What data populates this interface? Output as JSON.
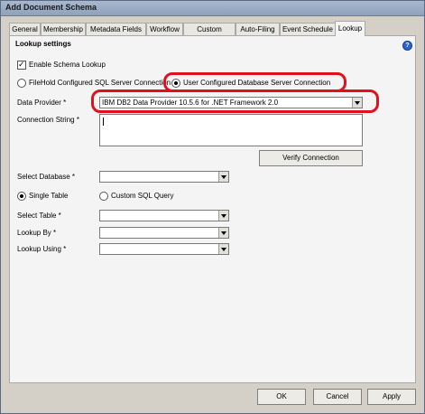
{
  "window": {
    "title": "Add Document Schema"
  },
  "tabs": [
    {
      "label": "General"
    },
    {
      "label": "Membership"
    },
    {
      "label": "Metadata Fields"
    },
    {
      "label": "Workflow"
    },
    {
      "label": "Custom Naming"
    },
    {
      "label": "Auto-Filing"
    },
    {
      "label": "Event Schedule"
    },
    {
      "label": "Lookup"
    }
  ],
  "lookup": {
    "heading": "Lookup settings",
    "help_icon": "question-icon",
    "enable_schema_lookup": {
      "label": "Enable Schema Lookup",
      "checked": true
    },
    "connection_type": {
      "option1": "FileHold Configured SQL Server Connection",
      "option2": "User Configured Database Server Connection",
      "selected": "User Configured Database Server Connection"
    },
    "data_provider": {
      "label": "Data Provider *",
      "value": "IBM DB2 Data Provider 10.5.6 for .NET Framework 2.0"
    },
    "connection_string": {
      "label": "Connection String *",
      "value": ""
    },
    "verify_button": "Verify Connection",
    "select_database": {
      "label": "Select Database *",
      "value": ""
    },
    "table_mode": {
      "option1": "Single Table",
      "option2": "Custom SQL Query",
      "selected": "Single Table"
    },
    "select_table": {
      "label": "Select Table *",
      "value": ""
    },
    "lookup_by": {
      "label": "Lookup By *",
      "value": ""
    },
    "lookup_using": {
      "label": "Lookup Using *",
      "value": ""
    }
  },
  "footer": {
    "ok": "OK",
    "cancel": "Cancel",
    "apply": "Apply"
  },
  "colors": {
    "highlight": "#e0101c",
    "help": "#2b65c9"
  }
}
